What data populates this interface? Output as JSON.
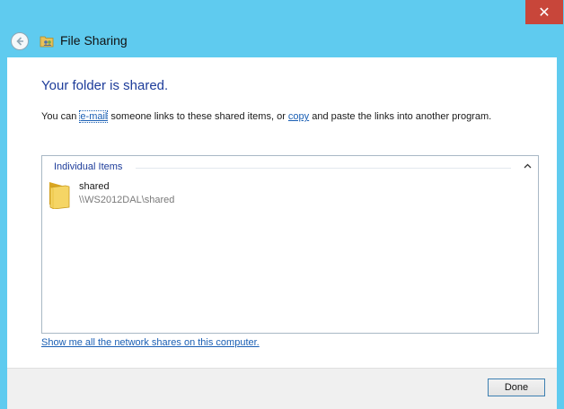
{
  "window": {
    "close_glyph": "✕"
  },
  "header": {
    "title": "File Sharing",
    "back_icon": "back-arrow-icon",
    "app_icon": "file-sharing-icon"
  },
  "main": {
    "heading": "Your folder is shared.",
    "description": {
      "prefix": "You can ",
      "email_link": "e-mail",
      "middle": " someone links to these shared items, or ",
      "copy_link": "copy",
      "suffix": " and paste the links into another program."
    },
    "group": {
      "label": "Individual Items",
      "collapse_icon": "chevron-up-icon"
    },
    "items": [
      {
        "name": "shared",
        "path": "\\\\WS2012DAL\\shared",
        "icon": "folder-icon"
      }
    ],
    "network_link": "Show me all the network shares on this computer."
  },
  "footer": {
    "done_label": "Done"
  },
  "colors": {
    "window_frame": "#5fcbef",
    "heading": "#1d3c9a",
    "link": "#1a5fb4",
    "close_button": "#c8463a"
  }
}
